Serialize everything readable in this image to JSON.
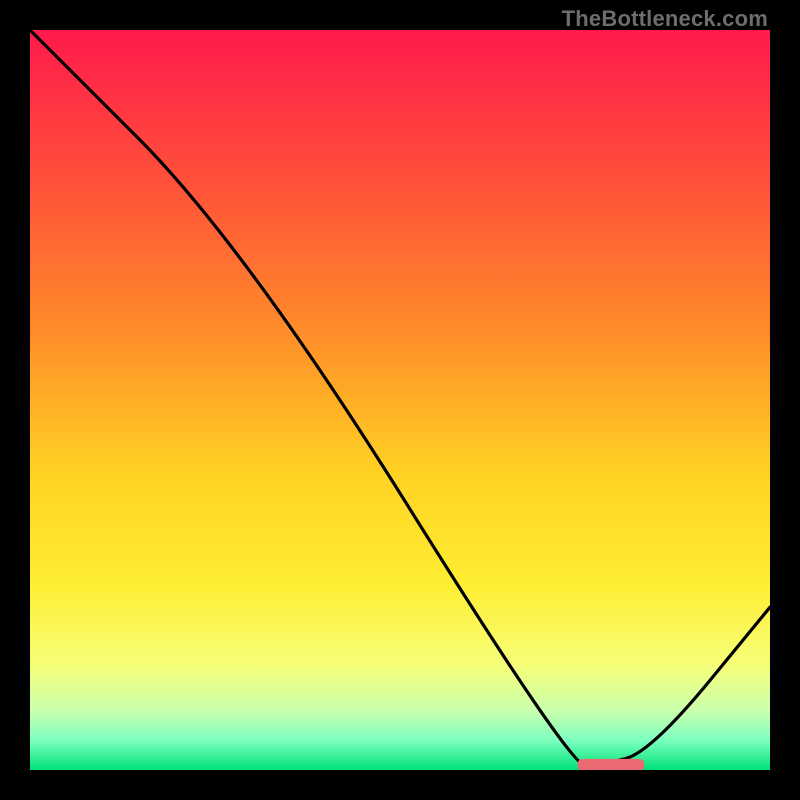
{
  "attribution": "TheBottleneck.com",
  "colors": {
    "black": "#000000",
    "attrib_text": "#6d6d6d",
    "marker_fill": "#e96a72",
    "gradient_stops": [
      {
        "offset": 0.0,
        "color": "#ff1a4b"
      },
      {
        "offset": 0.2,
        "color": "#ff4f3a"
      },
      {
        "offset": 0.4,
        "color": "#ff8a2a"
      },
      {
        "offset": 0.6,
        "color": "#ffd223"
      },
      {
        "offset": 0.75,
        "color": "#ffee33"
      },
      {
        "offset": 0.86,
        "color": "#f6ff7a"
      },
      {
        "offset": 0.92,
        "color": "#c9ffad"
      },
      {
        "offset": 0.96,
        "color": "#7bffbf"
      },
      {
        "offset": 1.0,
        "color": "#00e27a"
      }
    ]
  },
  "chart_data": {
    "type": "line",
    "x": [
      0.0,
      0.29,
      0.73,
      0.77,
      0.84,
      1.0
    ],
    "values": [
      1.0,
      0.71,
      0.006,
      0.006,
      0.025,
      0.22
    ],
    "title": "",
    "xlabel": "",
    "ylabel": "",
    "xlim": [
      0,
      1
    ],
    "ylim": [
      0,
      1
    ],
    "marker": {
      "x0": 0.74,
      "x1": 0.83,
      "y": 0.007
    }
  }
}
